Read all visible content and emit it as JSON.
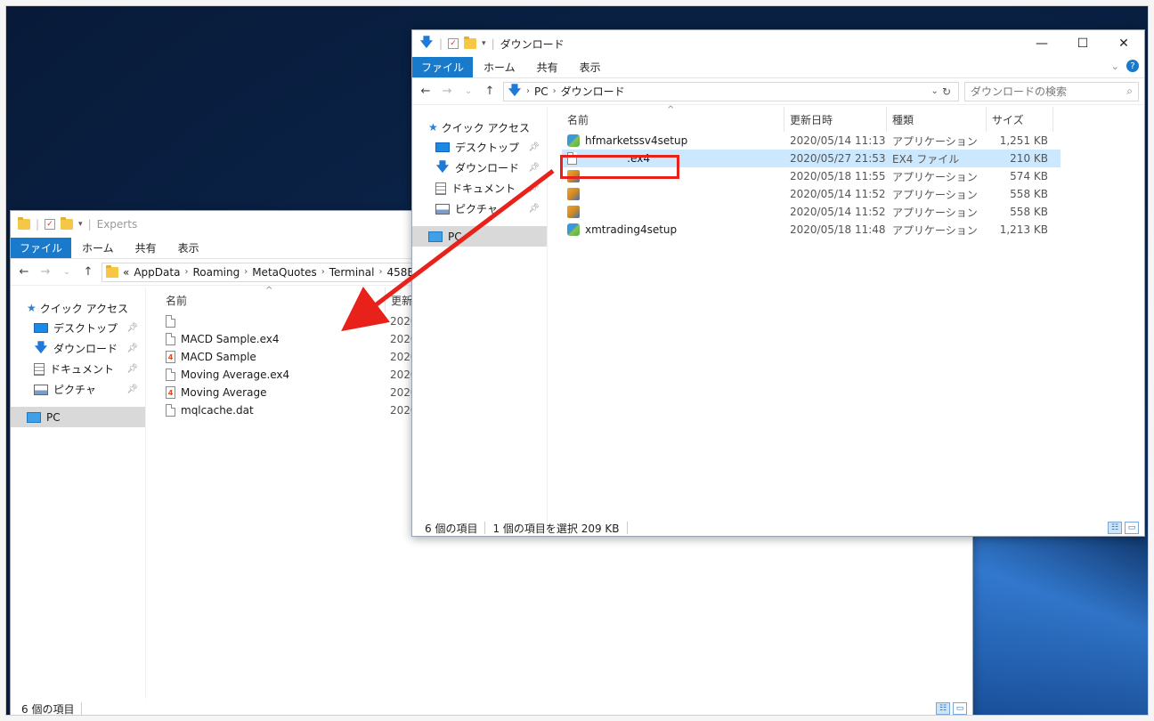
{
  "colors": {
    "accent": "#1979ca",
    "selection": "#cce8ff",
    "highlight": "#e8221a",
    "arrow": "#e8221a"
  },
  "back_window": {
    "title": "Experts",
    "ribbon": {
      "file": "ファイル",
      "tabs": [
        "ホーム",
        "共有",
        "表示"
      ]
    },
    "nav": {
      "back": "←",
      "forward": "→",
      "recent": "⌄",
      "up": "↑"
    },
    "address": {
      "prefix": "«",
      "crumbs": [
        "AppData",
        "Roaming",
        "MetaQuotes",
        "Terminal",
        "458EE"
      ]
    },
    "sidebar": {
      "quick_access": "クイック アクセス",
      "items": [
        {
          "label": "デスクトップ",
          "icon": "desktop-icon"
        },
        {
          "label": "ダウンロード",
          "icon": "download-icon"
        },
        {
          "label": "ドキュメント",
          "icon": "document-icon"
        },
        {
          "label": "ピクチャ",
          "icon": "pictures-icon"
        }
      ],
      "pc": "PC"
    },
    "columns": {
      "name": "名前",
      "modified": "更新日"
    },
    "files": [
      {
        "name": "",
        "date": "2020/",
        "icon": "file"
      },
      {
        "name": "MACD Sample.ex4",
        "date": "2020/",
        "icon": "file"
      },
      {
        "name": "MACD Sample",
        "date": "2020/",
        "icon": "mq4"
      },
      {
        "name": "Moving Average.ex4",
        "date": "2020/",
        "icon": "file"
      },
      {
        "name": "Moving Average",
        "date": "2020/",
        "icon": "mq4"
      },
      {
        "name": "mqlcache.dat",
        "date": "2020/",
        "icon": "file"
      }
    ],
    "status": {
      "count": "6 個の項目"
    }
  },
  "front_window": {
    "title": "ダウンロード",
    "controls": {
      "minimize": "—",
      "maximize": "☐",
      "close": "✕"
    },
    "ribbon": {
      "file": "ファイル",
      "tabs": [
        "ホーム",
        "共有",
        "表示"
      ],
      "expand": "⌄",
      "help": "?"
    },
    "nav": {
      "back": "←",
      "forward": "→",
      "recent": "⌄",
      "up": "↑"
    },
    "address": {
      "crumbs": [
        "PC",
        "ダウンロード"
      ],
      "dropdown": "⌄",
      "refresh": "↻"
    },
    "search": {
      "placeholder": "ダウンロードの検索",
      "icon": "⌕"
    },
    "sidebar": {
      "quick_access": "クイック アクセス",
      "items": [
        {
          "label": "デスクトップ",
          "icon": "desktop-icon"
        },
        {
          "label": "ダウンロード",
          "icon": "download-icon"
        },
        {
          "label": "ドキュメント",
          "icon": "document-icon"
        },
        {
          "label": "ピクチャ",
          "icon": "pictures-icon"
        }
      ],
      "pc": "PC"
    },
    "columns": {
      "name": "名前",
      "modified": "更新日時",
      "type": "種類",
      "size": "サイズ"
    },
    "files": [
      {
        "name": "hfmarketssv4setup",
        "date": "2020/05/14 11:13",
        "type": "アプリケーション",
        "size": "1,251 KB",
        "icon": "app",
        "selected": false
      },
      {
        "name": ":ex4",
        "date": "2020/05/27 21:53",
        "type": "EX4 ファイル",
        "size": "210 KB",
        "icon": "file",
        "selected": true
      },
      {
        "name": "",
        "date": "2020/05/18 11:55",
        "type": "アプリケーション",
        "size": "574 KB",
        "icon": "box",
        "selected": false
      },
      {
        "name": "",
        "date": "2020/05/14 11:52",
        "type": "アプリケーション",
        "size": "558 KB",
        "icon": "box",
        "selected": false
      },
      {
        "name": "",
        "date": "2020/05/14 11:52",
        "type": "アプリケーション",
        "size": "558 KB",
        "icon": "box",
        "selected": false
      },
      {
        "name": "xmtrading4setup",
        "date": "2020/05/18 11:48",
        "type": "アプリケーション",
        "size": "1,213 KB",
        "icon": "app",
        "selected": false
      }
    ],
    "status": {
      "count": "6 個の項目",
      "selection": "1 個の項目を選択  209 KB"
    }
  }
}
